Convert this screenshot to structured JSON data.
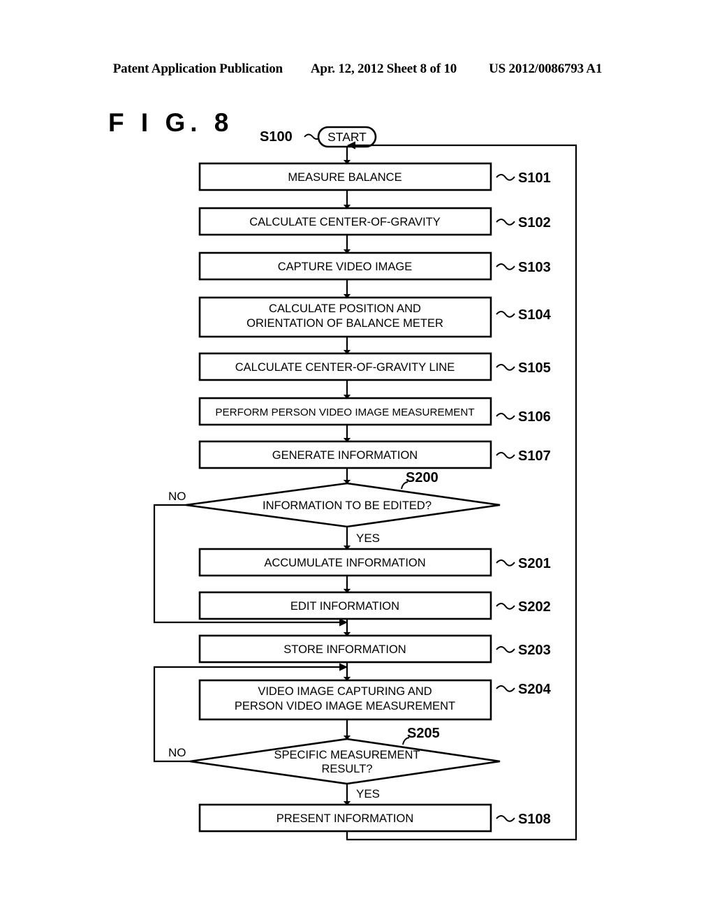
{
  "header": {
    "publication": "Patent Application Publication",
    "date_sheet": "Apr. 12, 2012  Sheet 8 of 10",
    "patent_number": "US 2012/0086793 A1"
  },
  "figure": {
    "title": "F I G.  8"
  },
  "flowchart": {
    "start": {
      "label": "START",
      "step": "S100"
    },
    "nodes": [
      {
        "step": "S101",
        "text": "MEASURE BALANCE",
        "type": "process"
      },
      {
        "step": "S102",
        "text": "CALCULATE CENTER-OF-GRAVITY",
        "type": "process"
      },
      {
        "step": "S103",
        "text": "CAPTURE VIDEO IMAGE",
        "type": "process"
      },
      {
        "step": "S104",
        "text_line1": "CALCULATE POSITION AND",
        "text_line2": "ORIENTATION OF BALANCE METER",
        "type": "process"
      },
      {
        "step": "S105",
        "text": "CALCULATE CENTER-OF-GRAVITY LINE",
        "type": "process"
      },
      {
        "step": "S106",
        "text": "PERFORM PERSON VIDEO IMAGE MEASUREMENT",
        "type": "process"
      },
      {
        "step": "S107",
        "text": "GENERATE INFORMATION",
        "type": "process"
      },
      {
        "step": "S200",
        "text": "INFORMATION TO BE EDITED?",
        "type": "decision",
        "yes": "YES",
        "no": "NO"
      },
      {
        "step": "S201",
        "text": "ACCUMULATE INFORMATION",
        "type": "process"
      },
      {
        "step": "S202",
        "text": "EDIT INFORMATION",
        "type": "process"
      },
      {
        "step": "S203",
        "text": "STORE INFORMATION",
        "type": "process"
      },
      {
        "step": "S204",
        "text_line1": "VIDEO IMAGE CAPTURING AND",
        "text_line2": "PERSON VIDEO IMAGE MEASUREMENT",
        "type": "process"
      },
      {
        "step": "S205",
        "text_line1": "SPECIFIC MEASUREMENT",
        "text_line2": "RESULT?",
        "type": "decision",
        "yes": "YES",
        "no": "NO"
      },
      {
        "step": "S108",
        "text": "PRESENT INFORMATION",
        "type": "process"
      }
    ]
  },
  "colors": {
    "stroke": "#000000",
    "background": "#ffffff"
  }
}
